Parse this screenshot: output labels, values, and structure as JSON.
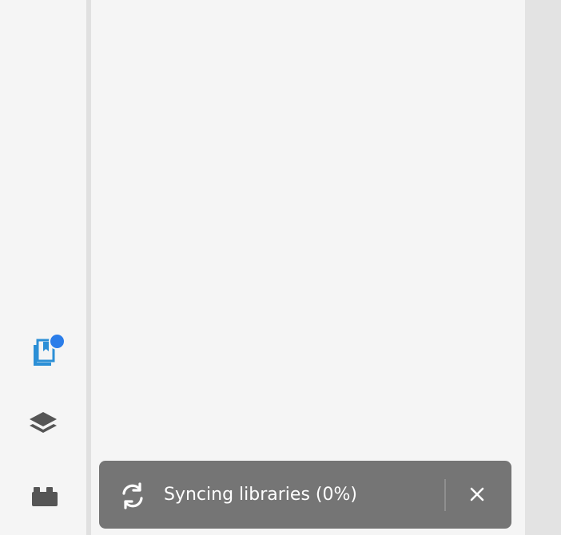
{
  "rail": {
    "items": [
      {
        "icon": "library-bookmark-icon",
        "active": true,
        "has_notification": true,
        "accent": "#2b7de9"
      },
      {
        "icon": "layers-icon",
        "active": false
      },
      {
        "icon": "plugins-icon",
        "active": false
      }
    ]
  },
  "toast": {
    "message": "Syncing libraries (0%)",
    "progress_percent": 0,
    "icon": "sync-icon",
    "close_icon": "close-icon",
    "background": "#757575"
  }
}
